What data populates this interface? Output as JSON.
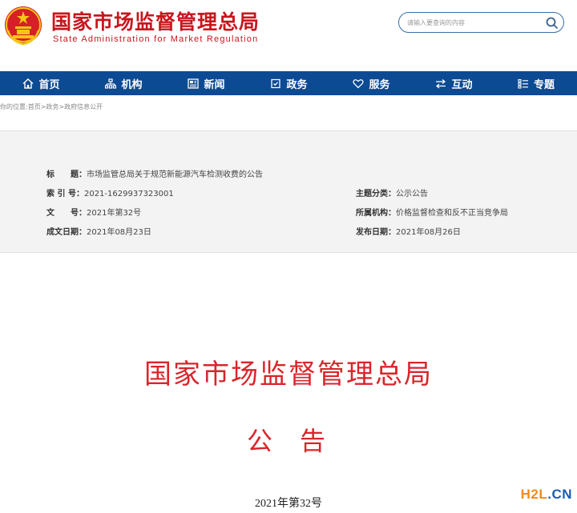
{
  "header": {
    "title": "国家市场监督管理总局",
    "subtitle": "State Administration for Market Regulation",
    "emblem_icon": "national-emblem-icon",
    "search": {
      "placeholder": "请输入要查询的内容",
      "value": "",
      "icon": "search-icon"
    }
  },
  "nav": {
    "items": [
      {
        "label": "首页",
        "icon": "home-icon"
      },
      {
        "label": "机构",
        "icon": "org-chart-icon"
      },
      {
        "label": "新闻",
        "icon": "newspaper-icon"
      },
      {
        "label": "政务",
        "icon": "shield-icon"
      },
      {
        "label": "服务",
        "icon": "heart-icon"
      },
      {
        "label": "互动",
        "icon": "exchange-icon"
      },
      {
        "label": "专题",
        "icon": "list-icon"
      }
    ]
  },
  "breadcrumb": {
    "prefix": "你的位置:",
    "items": [
      "首页",
      "政务",
      "政府信息公开"
    ],
    "separator": ">"
  },
  "info": {
    "title_label": "标　　题：",
    "title_value": "市场监管总局关于规范新能源汽车检测收费的公告",
    "index_label": "索 引 号：",
    "index_value": "2021-1629937323001",
    "topic_label": "主题分类：",
    "topic_value": "公示公告",
    "docno_label": "文　　号：",
    "docno_value": "2021年第32号",
    "agency_label": "所属机构：",
    "agency_value": "价格监督检查和反不正当竞争局",
    "created_label": "成文日期：",
    "created_value": "2021年08月23日",
    "published_label": "发布日期：",
    "published_value": "2021年08月26日"
  },
  "document": {
    "org": "国家市场监督管理总局",
    "type": "公告",
    "number": "2021年第32号"
  },
  "watermark": {
    "part_a": "H2L",
    "part_b": ".CN"
  },
  "colors": {
    "brand_red": "#c8161d",
    "nav_blue": "#0d4a94",
    "doc_red": "#d9252b"
  }
}
